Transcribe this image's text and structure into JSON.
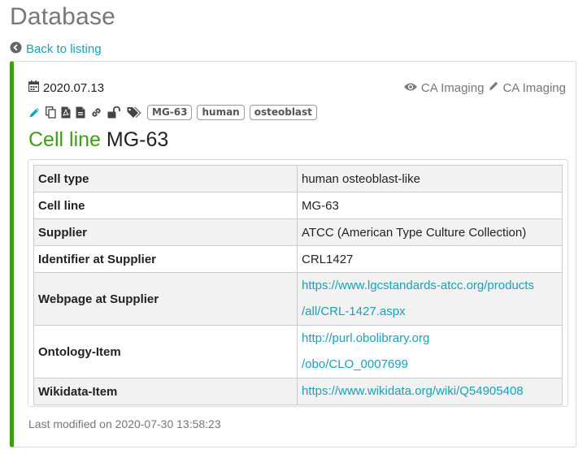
{
  "page": {
    "title": "Database"
  },
  "back": {
    "label": "Back to listing"
  },
  "entry": {
    "date": "2020.07.13",
    "owner": "CA Imaging",
    "editor": "CA Imaging",
    "tags": [
      "MG-63",
      "human",
      "osteoblast"
    ],
    "kind": "Cell line",
    "name": "MG-63",
    "last_modified": "Last modified on 2020-07-30 13:58:23"
  },
  "table": {
    "rows": [
      {
        "key": "Cell type",
        "value": "human osteoblast-like"
      },
      {
        "key": "Cell line",
        "value": "MG-63"
      },
      {
        "key": "Supplier",
        "value": "ATCC (American Type Culture Collection)"
      },
      {
        "key": "Identifier at Supplier",
        "value": "CRL1427"
      },
      {
        "key": "Webpage at Supplier",
        "line1": "https://www.lgcstandards-atcc.org/products",
        "line2": "/all/CRL-1427.aspx"
      },
      {
        "key": "Ontology-Item",
        "line1": "http://purl.obolibrary.org",
        "line2": "/obo/CLO_0007699"
      },
      {
        "key": "Wikidata-Item",
        "value": "https://www.wikidata.org/wiki/Q54905408"
      }
    ]
  },
  "icons": {
    "edit": "pencil-icon",
    "duplicate": "copy-icon",
    "pdf": "file-pdf-icon",
    "file": "file-icon",
    "link": "link-icon",
    "lock": "unlock-icon",
    "tags": "tags-icon"
  },
  "colors": {
    "accent": "#3c9e14",
    "link": "#17a2b8",
    "muted": "#777777"
  }
}
